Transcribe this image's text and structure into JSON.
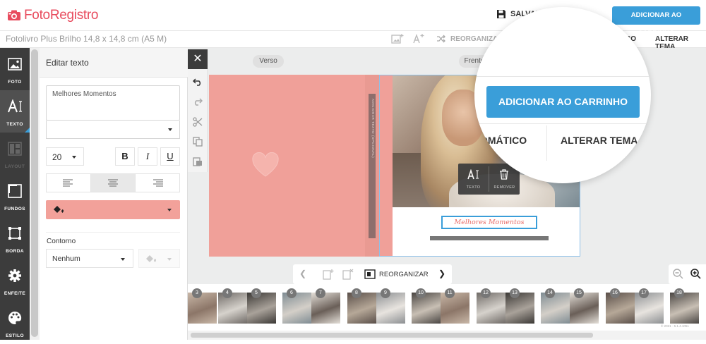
{
  "header": {
    "brand": "FotoRegistro",
    "save_label": "SALVAR",
    "cart_label": "ADICIONAR AO CARRINHO"
  },
  "subbar": {
    "product_title": "Fotolivro Plus Brilho 14,8 x 14,8 cm (A5 M)",
    "reorg_auto_label": "REORGANIZAR A",
    "auto_tail": "CO",
    "theme_label": "ALTERAR TEMA"
  },
  "sidebar": {
    "items": [
      {
        "label": "FOTO",
        "icon": "image-icon"
      },
      {
        "label": "TEXTO",
        "icon": "text-icon",
        "active": true
      },
      {
        "label": "LAYOUT",
        "icon": "layout-icon",
        "disabled": true
      },
      {
        "label": "FUNDOS",
        "icon": "background-icon"
      },
      {
        "label": "BORDA",
        "icon": "border-icon"
      },
      {
        "label": "ENFEITE",
        "icon": "gear-icon"
      },
      {
        "label": "ESTILO",
        "icon": "palette-icon"
      }
    ]
  },
  "panel": {
    "title": "Editar texto",
    "text_value": "Melhores Momentos",
    "font_size": "20",
    "bold": "B",
    "italic": "I",
    "underline": "U",
    "fill_color": "#f2a19a",
    "outline_label": "Contorno",
    "outline_value": "Nenhum"
  },
  "canvas": {
    "back_label": "Verso",
    "front_label": "Frente",
    "spine_text": "ADICIONAR TEXTO (OPCIONAL)",
    "caption": "Melhores Momentos",
    "popup_text_label": "TEXTO",
    "popup_remove_label": "REMOVER",
    "page_color": "#f0a099",
    "accent": "#3a9ed9"
  },
  "magnifier": {
    "cart_label": "ADICIONAR AO CARRINHO",
    "auto_label": "OMÁTICO",
    "theme_label": "ALTERAR TEMA"
  },
  "pagenav": {
    "reorg_label": "REORGANIZAR"
  },
  "thumbnails": {
    "numbers": [
      "3",
      "4",
      "5",
      "6",
      "7",
      "8",
      "9",
      "10",
      "11",
      "12",
      "13",
      "14",
      "15",
      "16",
      "17",
      "18"
    ]
  },
  "footer": {
    "copyright": "© 2021 · 5.1.4.1051"
  }
}
